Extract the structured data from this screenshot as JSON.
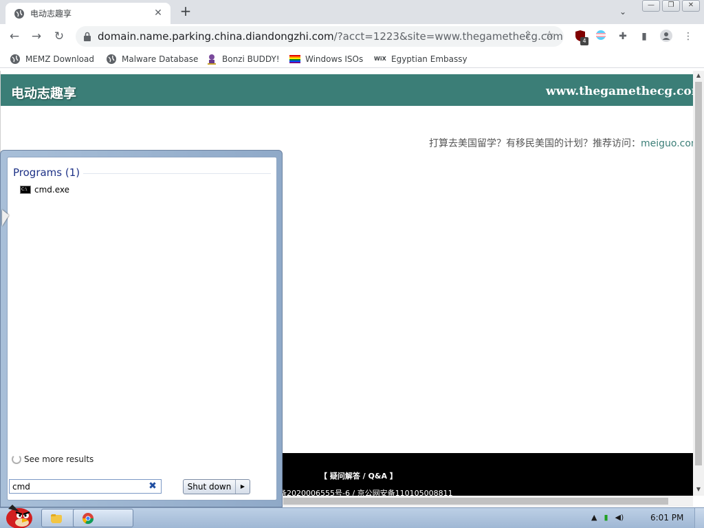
{
  "browser": {
    "tab_title": "电动志趣享",
    "tab_close": "✕",
    "new_tab": "+",
    "url_host": "domain.name.parking.china.diandongzhi.com",
    "url_rest": "/?acct=1223&site=www.thegamethecg.com",
    "extension_badge": "4",
    "window_buttons": [
      "—",
      "❐",
      "✕"
    ],
    "bookmarks": [
      {
        "label": "MEMZ Download",
        "icon": "globe-icon"
      },
      {
        "label": "Malware Database",
        "icon": "globe-icon"
      },
      {
        "label": "Bonzi BUDDY!",
        "icon": "bonzi-icon"
      },
      {
        "label": "Windows ISOs",
        "icon": "rainbow-flag-icon"
      },
      {
        "label": "Egyptian Embassy",
        "icon": "wix-icon"
      }
    ]
  },
  "site": {
    "logo": "电动志趣享",
    "domain": "www.thegamethecg.com",
    "promo_text": "打算去美国留学？有移民美国的计划？推荐访问：",
    "promo_link": "meiguo.com",
    "footer_qa": "【 疑问解答 / Q&A 】",
    "footer_icp": "备2020006555号-6 / 京公网安备110105008811"
  },
  "start_menu": {
    "heading": "Programs (1)",
    "result": "cmd.exe",
    "see_more": "See more results",
    "search_value": "cmd",
    "shutdown_label": "Shut down"
  },
  "taskbar": {
    "clock": "6:01 PM",
    "tray": [
      "▲",
      "▮",
      "◀)"
    ]
  },
  "colors": {
    "site_header": "#3b7e77",
    "start_menu_heading": "#1e3287"
  }
}
